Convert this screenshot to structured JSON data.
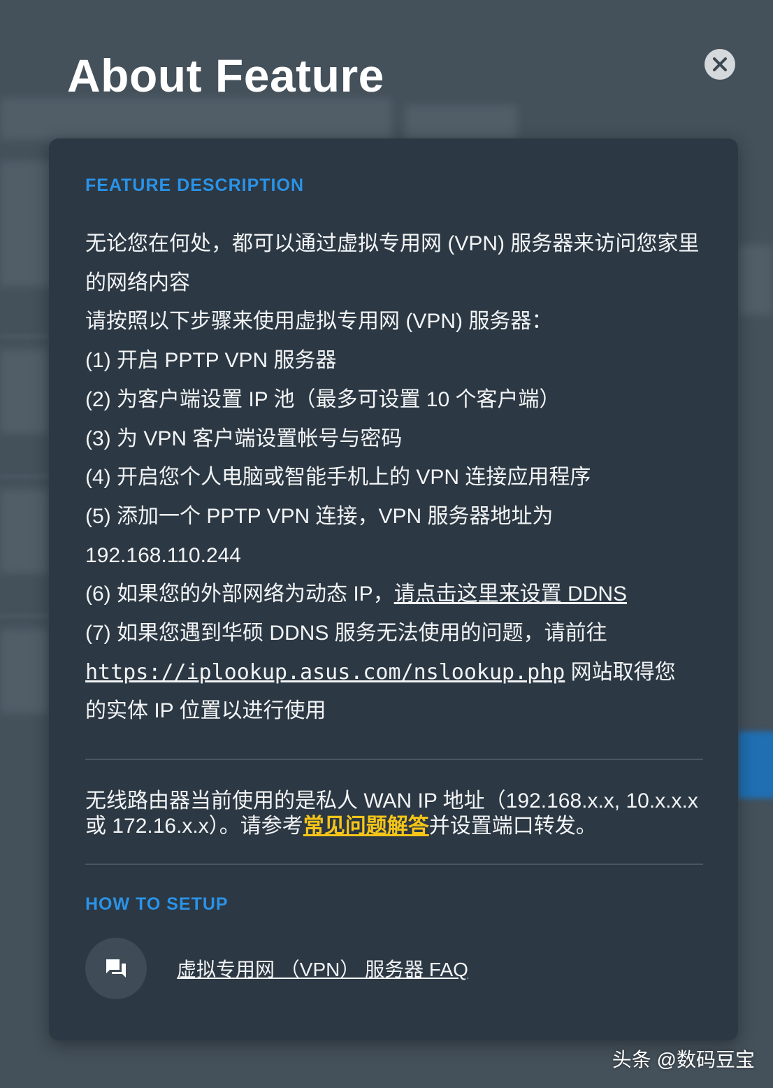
{
  "modal": {
    "title": "About Feature",
    "close_icon": "close-icon"
  },
  "feature_description": {
    "heading": "FEATURE DESCRIPTION",
    "intro": "无论您在何处，都可以通过虚拟专用网 (VPN) 服务器来访问您家里的网络内容",
    "steps_intro": "请按照以下步骤来使用虚拟专用网 (VPN) 服务器：",
    "step1": "(1) 开启 PPTP VPN 服务器",
    "step2": "(2) 为客户端设置 IP 池（最多可设置 10 个客户端）",
    "step3": "(3) 为 VPN 客户端设置帐号与密码",
    "step4": "(4) 开启您个人电脑或智能手机上的 VPN 连接应用程序",
    "step5_prefix": "(5) 添加一个 PPTP VPN 连接，VPN 服务器地址为",
    "server_ip": "192.168.110.244",
    "step6_prefix": "(6) 如果您的外部网络为动态 IP，",
    "step6_link": "请点击这里来设置 DDNS",
    "step7_prefix": "(7) 如果您遇到华硕 DDNS 服务无法使用的问题，请前往",
    "step7_url": "https://iplookup.asus.com/nslookup.php",
    "step7_suffix_a": " 网站取得您",
    "step7_suffix_b": "的实体 IP 位置以进行使用"
  },
  "wan_notice": {
    "prefix": "无线路由器当前使用的是私人 WAN IP 地址（192.168.x.x, 10.x.x.x 或 172.16.x.x）。请参考",
    "faq_link": "常见问题解答",
    "suffix": "并设置端口转发。"
  },
  "how_to_setup": {
    "heading": "HOW TO SETUP",
    "faq_icon": "chat-bubbles-icon",
    "faq_link": "虚拟专用网 （VPN） 服务器 FAQ"
  },
  "watermark": "头条 @数码豆宝"
}
